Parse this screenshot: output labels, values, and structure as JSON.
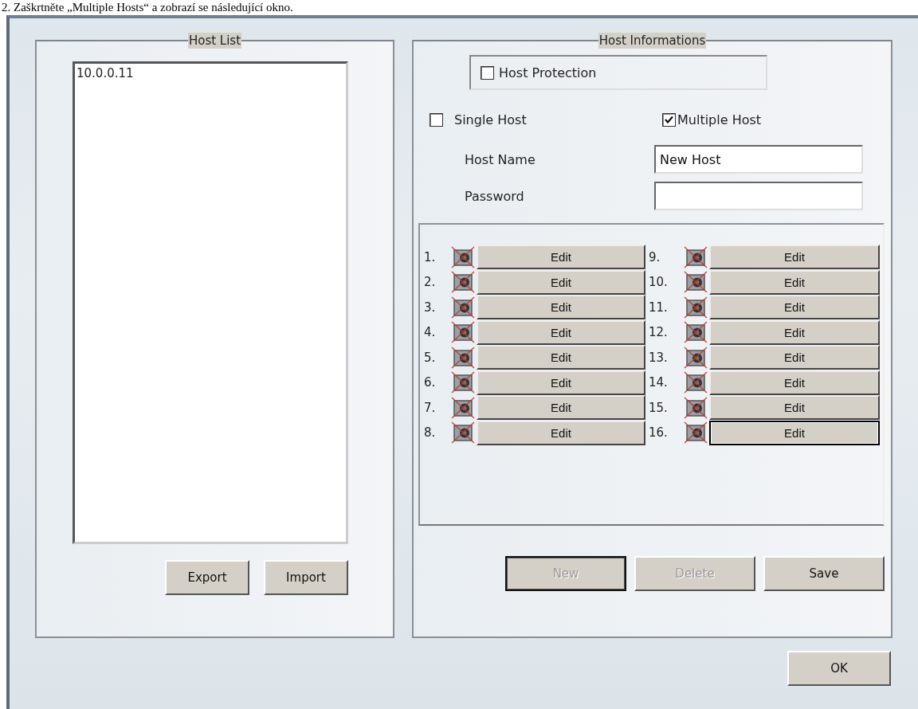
{
  "caption": "2.   Zaškrtněte „Multiple Hosts“ a zobrazí se následující okno.",
  "host_list": {
    "title": "Host List",
    "items": [
      {
        "label": "10.0.0.11",
        "selected": false
      }
    ],
    "buttons": [
      {
        "label": "Export",
        "disabled": false,
        "focused": false
      },
      {
        "label": "Import",
        "disabled": false,
        "focused": false
      }
    ]
  },
  "host_info": {
    "title": "Host Informations",
    "protection": {
      "label": "Host Protection",
      "checked": false
    },
    "modes": [
      {
        "label": "Single Host",
        "checked": false
      },
      {
        "label": "Multiple Host",
        "checked": true
      }
    ],
    "fields": [
      {
        "label": "Host Name",
        "value": "New Host"
      },
      {
        "label": "Password"
      }
    ],
    "slots": [
      {
        "number": "1.",
        "button": "Edit",
        "focused": false
      },
      {
        "number": "2.",
        "button": "Edit",
        "focused": false
      },
      {
        "number": "3.",
        "button": "Edit",
        "focused": false
      },
      {
        "number": "4.",
        "button": "Edit",
        "focused": false
      },
      {
        "number": "5.",
        "button": "Edit",
        "focused": false
      },
      {
        "number": "6.",
        "button": "Edit",
        "focused": false
      },
      {
        "number": "7.",
        "button": "Edit",
        "focused": false
      },
      {
        "number": "8.",
        "button": "Edit",
        "focused": false
      },
      {
        "number": "9.",
        "button": "Edit",
        "focused": false
      },
      {
        "number": "10.",
        "button": "Edit",
        "focused": false
      },
      {
        "number": "11.",
        "button": "Edit",
        "focused": false
      },
      {
        "number": "12.",
        "button": "Edit",
        "focused": false
      },
      {
        "number": "13.",
        "button": "Edit",
        "focused": false
      },
      {
        "number": "14.",
        "button": "Edit",
        "focused": false
      },
      {
        "number": "15.",
        "button": "Edit",
        "focused": false
      },
      {
        "number": "16.",
        "button": "Edit",
        "focused": true
      }
    ],
    "buttons": [
      {
        "label": "New",
        "disabled": true,
        "focused": true
      },
      {
        "label": "Delete",
        "disabled": true,
        "focused": false
      },
      {
        "label": "Save",
        "disabled": false,
        "focused": false
      }
    ]
  },
  "ok_button": {
    "label": "OK",
    "disabled": false,
    "focused": false
  }
}
